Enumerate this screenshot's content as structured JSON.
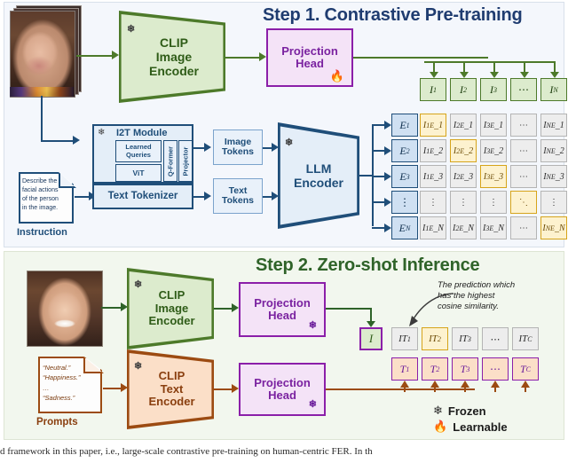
{
  "figure": {
    "step1": {
      "title": "Step 1. Contrastive Pre-training",
      "clip_image_encoder": "CLIP\nImage\nEncoder",
      "clip_image_encoder_l1": "CLIP",
      "clip_image_encoder_l2": "Image",
      "clip_image_encoder_l3": "Encoder",
      "projection_head_l1": "Projection",
      "projection_head_l2": "Head",
      "i2t_module": "I2T Module",
      "learned_queries_l1": "Learned",
      "learned_queries_l2": "Queries",
      "vit": "ViT",
      "qformer": "Q-Former",
      "projector": "Projector",
      "image_tokens_l1": "Image",
      "image_tokens_l2": "Tokens",
      "text_tokens_l1": "Text",
      "text_tokens_l2": "Tokens",
      "text_tokenizer": "Text Tokenizer",
      "llm_encoder_l1": "LLM",
      "llm_encoder_l2": "Encoder",
      "instruction_label": "Instruction",
      "instruction_lines": [
        "Describe the",
        "facial actions",
        "of the person",
        "in the image."
      ]
    },
    "step2": {
      "title": "Step 2. Zero-shot Inference",
      "clip_image_encoder_l1": "CLIP",
      "clip_image_encoder_l2": "Image",
      "clip_image_encoder_l3": "Encoder",
      "clip_text_encoder_l1": "CLIP",
      "clip_text_encoder_l2": "Text",
      "clip_text_encoder_l3": "Encoder",
      "projection_head_l1": "Projection",
      "projection_head_l2": "Head",
      "prompts_label": "Prompts",
      "prompt_lines": [
        "“Neutral.”",
        "“Happiness.”",
        "…",
        "“Sadness.”"
      ],
      "annotation_lines": [
        "The prediction which",
        "has the highest",
        "cosine similarity."
      ]
    },
    "legend": {
      "frozen": "Frozen",
      "learnable": "Learnable",
      "frozen_icon": "snowflake-icon",
      "learnable_icon": "flame-icon"
    },
    "tokens": {
      "image_row": [
        "I_1",
        "I_2",
        "I_3",
        "⋯",
        "I_N"
      ],
      "image_row_sub": [
        "1",
        "2",
        "3",
        "",
        "N"
      ],
      "text_col": [
        "E_1",
        "E_2",
        "E_3",
        "⋮",
        "E_N"
      ],
      "text_col_sub": [
        "1",
        "2",
        "3",
        "",
        "N"
      ],
      "inference_image": "I",
      "inference_it": [
        "IT_1",
        "IT_2",
        "IT_3",
        "⋯",
        "IT_C"
      ],
      "inference_it_sub": [
        "1",
        "2",
        "3",
        "",
        "C"
      ],
      "inference_t": [
        "T_1",
        "T_2",
        "T_3",
        "⋯",
        "T_C"
      ],
      "inference_t_sub": [
        "1",
        "2",
        "3",
        "",
        "C"
      ]
    },
    "matrix": {
      "rows": [
        [
          "I_1E_1",
          "I_2E_1",
          "I_3E_1",
          "⋯",
          "I_NE_1"
        ],
        [
          "I_1E_2",
          "I_2E_2",
          "I_3E_2",
          "⋯",
          "I_NE_2"
        ],
        [
          "I_1E_3",
          "I_2E_3",
          "I_3E_3",
          "⋯",
          "I_NE_3"
        ],
        [
          "⋮",
          "⋮",
          "⋮",
          "⋱",
          "⋮"
        ],
        [
          "I_1E_N",
          "I_2E_N",
          "I_3E_N",
          "⋯",
          "I_NE_N"
        ]
      ],
      "diagonal": [
        [
          0,
          0
        ],
        [
          1,
          1
        ],
        [
          2,
          2
        ],
        [
          3,
          3
        ],
        [
          4,
          4
        ]
      ]
    },
    "caption": "d framework in this paper, i.e., large-scale contrastive pre-training on human-centric FER. In th"
  },
  "colors": {
    "step1_bg": "#f4f7fc",
    "step2_bg": "#f2f7ee",
    "title1": "#1f3c70",
    "title2": "#2f6329",
    "green_edge": "#4d7a2a",
    "green_fill": "#dcebcd",
    "blue_edge": "#1f4e79",
    "blue_fill": "#e4eef8",
    "purple_edge": "#8b1fa9",
    "purple_fill": "#f4e3f7",
    "orange_edge": "#9c4b12",
    "orange_fill": "#fbdfc8",
    "highlight": "#d6a41b",
    "highlight_fill": "#fdf2cf",
    "gray_fill": "#ededed",
    "gray_edge": "#b4b4b4"
  }
}
